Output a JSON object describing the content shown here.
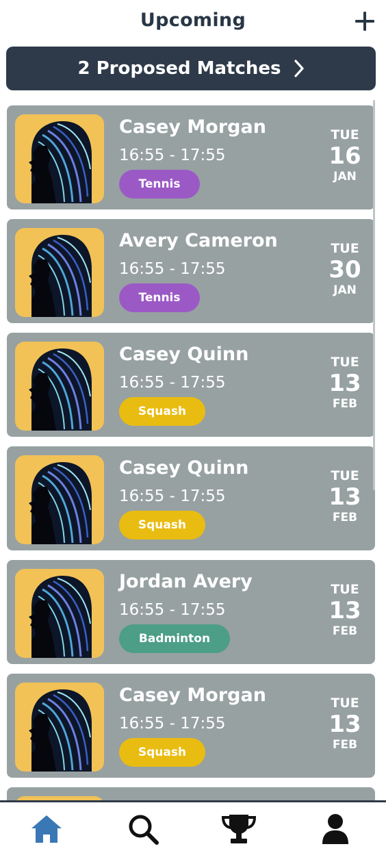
{
  "header": {
    "title": "Upcoming",
    "add_icon": "plus-icon"
  },
  "proposed": {
    "label": "2 Proposed Matches",
    "icon": "chevron-right-icon"
  },
  "matches": [
    {
      "name": "Casey Morgan",
      "time": "16:55 - 17:55",
      "sport": "Tennis",
      "sport_color": "#9b59c6",
      "dow": "TUE",
      "day": "16",
      "month": "JAN"
    },
    {
      "name": "Avery Cameron",
      "time": "16:55 - 17:55",
      "sport": "Tennis",
      "sport_color": "#9b59c6",
      "dow": "TUE",
      "day": "30",
      "month": "JAN"
    },
    {
      "name": "Casey Quinn",
      "time": "16:55 - 17:55",
      "sport": "Squash",
      "sport_color": "#e9bc11",
      "dow": "TUE",
      "day": "13",
      "month": "FEB"
    },
    {
      "name": "Casey Quinn",
      "time": "16:55 - 17:55",
      "sport": "Squash",
      "sport_color": "#e9bc11",
      "dow": "TUE",
      "day": "13",
      "month": "FEB"
    },
    {
      "name": "Jordan Avery",
      "time": "16:55 - 17:55",
      "sport": "Badminton",
      "sport_color": "#4c9e86",
      "dow": "TUE",
      "day": "13",
      "month": "FEB"
    },
    {
      "name": "Casey Morgan",
      "time": "16:55 - 17:55",
      "sport": "Squash",
      "sport_color": "#e9bc11",
      "dow": "TUE",
      "day": "13",
      "month": "FEB"
    }
  ],
  "nav": [
    {
      "icon": "home-icon",
      "active": true
    },
    {
      "icon": "search-icon",
      "active": false
    },
    {
      "icon": "trophy-icon",
      "active": false
    },
    {
      "icon": "profile-icon",
      "active": false
    }
  ],
  "colors": {
    "header_text": "#283645",
    "banner_bg": "#2e3a49",
    "card_bg": "#97a1a2",
    "avatar_bg": "#f2c257",
    "nav_active": "#3a78b5",
    "nav_inactive": "#111111"
  }
}
